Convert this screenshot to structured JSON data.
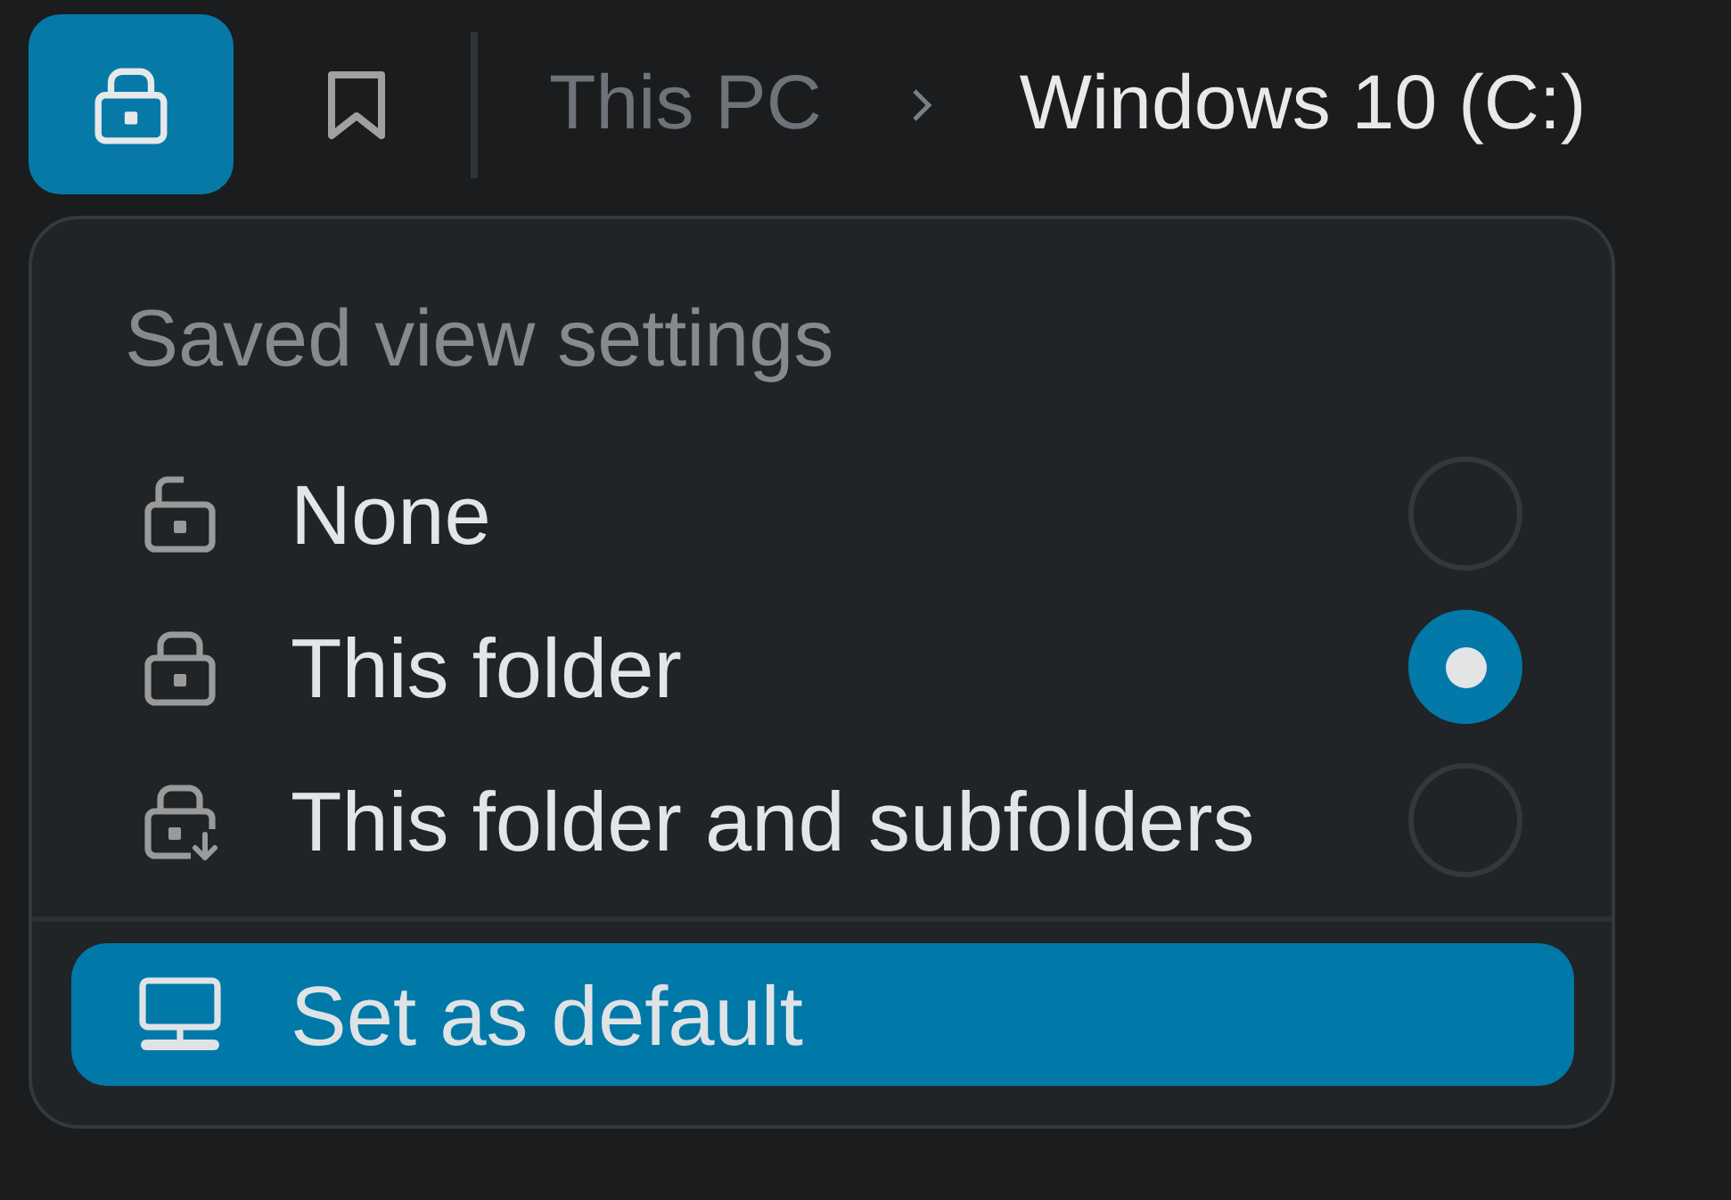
{
  "toolbar": {
    "buttons": [
      {
        "kind": "lock",
        "active": true
      },
      {
        "kind": "bookmark",
        "active": false
      }
    ]
  },
  "breadcrumb": [
    {
      "label": "This PC",
      "current": false
    },
    {
      "label": "Windows 10 (C:)",
      "current": true
    }
  ],
  "menu": {
    "title": "Saved view settings",
    "options": [
      {
        "label": "None",
        "kind": "unlocked",
        "selected": false
      },
      {
        "label": "This folder",
        "kind": "locked",
        "selected": true
      },
      {
        "label": "This folder and subfolders",
        "kind": "locked-subfolders",
        "selected": false
      }
    ],
    "action": {
      "label": "Set as default",
      "highlighted": true
    }
  }
}
